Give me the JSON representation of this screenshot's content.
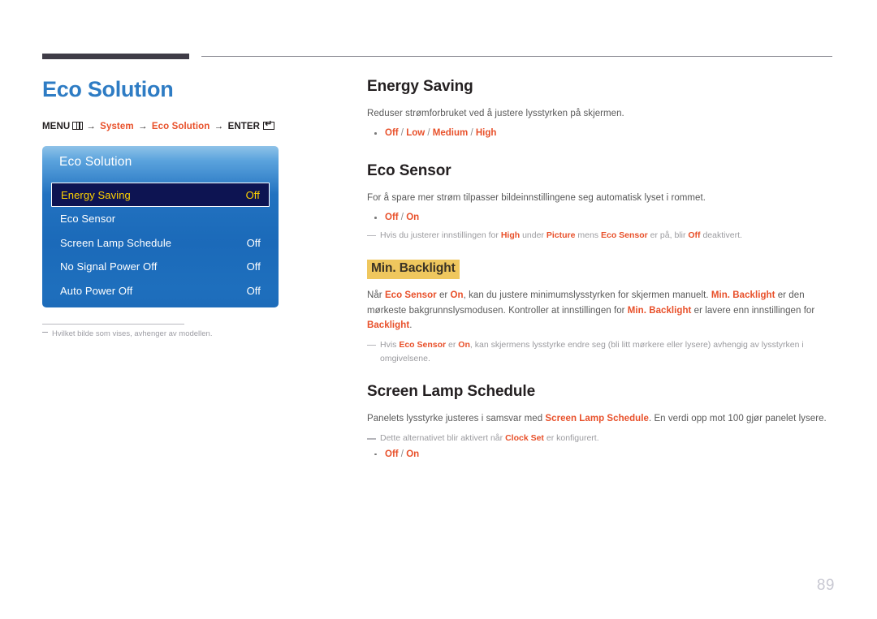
{
  "page": {
    "number": "89",
    "title": "Eco Solution"
  },
  "menu_path": {
    "menu_label": "MENU",
    "menu_icon": "menu-grid-icon",
    "arrow": "→",
    "step1": "System",
    "step2": "Eco Solution",
    "enter_label": "ENTER",
    "enter_icon": "enter-key-icon"
  },
  "osd": {
    "title": "Eco Solution",
    "rows": [
      {
        "label": "Energy Saving",
        "value": "Off",
        "selected": true
      },
      {
        "label": "Eco Sensor",
        "value": "",
        "selected": false
      },
      {
        "label": "Screen Lamp Schedule",
        "value": "Off",
        "selected": false
      },
      {
        "label": "No Signal Power Off",
        "value": "Off",
        "selected": false
      },
      {
        "label": "Auto Power Off",
        "value": "Off",
        "selected": false
      }
    ]
  },
  "left_note": "Hvilket bilde som vises, avhenger av modellen.",
  "sections": {
    "energy_saving": {
      "heading": "Energy Saving",
      "body": "Reduser strømforbruket ved å justere lysstyrken på skjermen.",
      "options": {
        "o1": "Off",
        "o2": "Low",
        "o3": "Medium",
        "o4": "High"
      }
    },
    "eco_sensor": {
      "heading": "Eco Sensor",
      "body": "For å spare mer strøm tilpasser bildeinnstillingene seg automatisk lyset i rommet.",
      "options": {
        "o1": "Off",
        "o2": "On"
      },
      "note": {
        "t1": "Hvis du justerer innstillingen for ",
        "a1": "High",
        "t2": " under ",
        "a2": "Picture",
        "t3": " mens ",
        "a3": "Eco Sensor",
        "t4": " er på, blir ",
        "a4": "Off",
        "t5": " deaktivert."
      }
    },
    "min_backlight": {
      "heading": "Min. Backlight",
      "body": {
        "t1": "Når ",
        "a1": "Eco Sensor",
        "t2": " er ",
        "a2": "On",
        "t3": ", kan du justere minimumslysstyrken for skjermen manuelt. ",
        "a3": "Min. Backlight",
        "t4": " er den mørkeste bakgrunnslysmodusen. Kontroller at innstillingen for ",
        "a4": "Min. Backlight",
        "t5": " er lavere enn innstillingen for ",
        "a5": "Backlight",
        "t6": "."
      },
      "note": {
        "t1": "Hvis ",
        "a1": "Eco Sensor",
        "t2": " er ",
        "a2": "On",
        "t3": ", kan skjermens lysstyrke endre seg (bli litt mørkere eller lysere) avhengig av lysstyrken i omgivelsene."
      }
    },
    "screen_lamp_schedule": {
      "heading": "Screen Lamp Schedule",
      "body": {
        "t1": "Panelets lysstyrke justeres i samsvar med ",
        "a1": "Screen Lamp Schedule",
        "t2": ". En verdi opp mot 100 gjør panelet lysere."
      },
      "note": {
        "t1": "Dette alternativet blir aktivert når ",
        "a1": "Clock Set",
        "t2": " er konfigurert."
      },
      "options": {
        "o1": "Off",
        "o2": "On"
      }
    }
  },
  "colors": {
    "title_blue": "#2e7cc4",
    "accent_orange": "#e8502a",
    "osd_blue": "#1d6cba",
    "osd_selected_bg": "#0d1452",
    "osd_selected_text": "#ffd200",
    "highlight_yellow": "#efc75e",
    "body_gray": "#595959",
    "note_gray": "#9b9b9f",
    "rule_dark": "#3f3c47",
    "page_number_gray": "#c8c8d2"
  }
}
